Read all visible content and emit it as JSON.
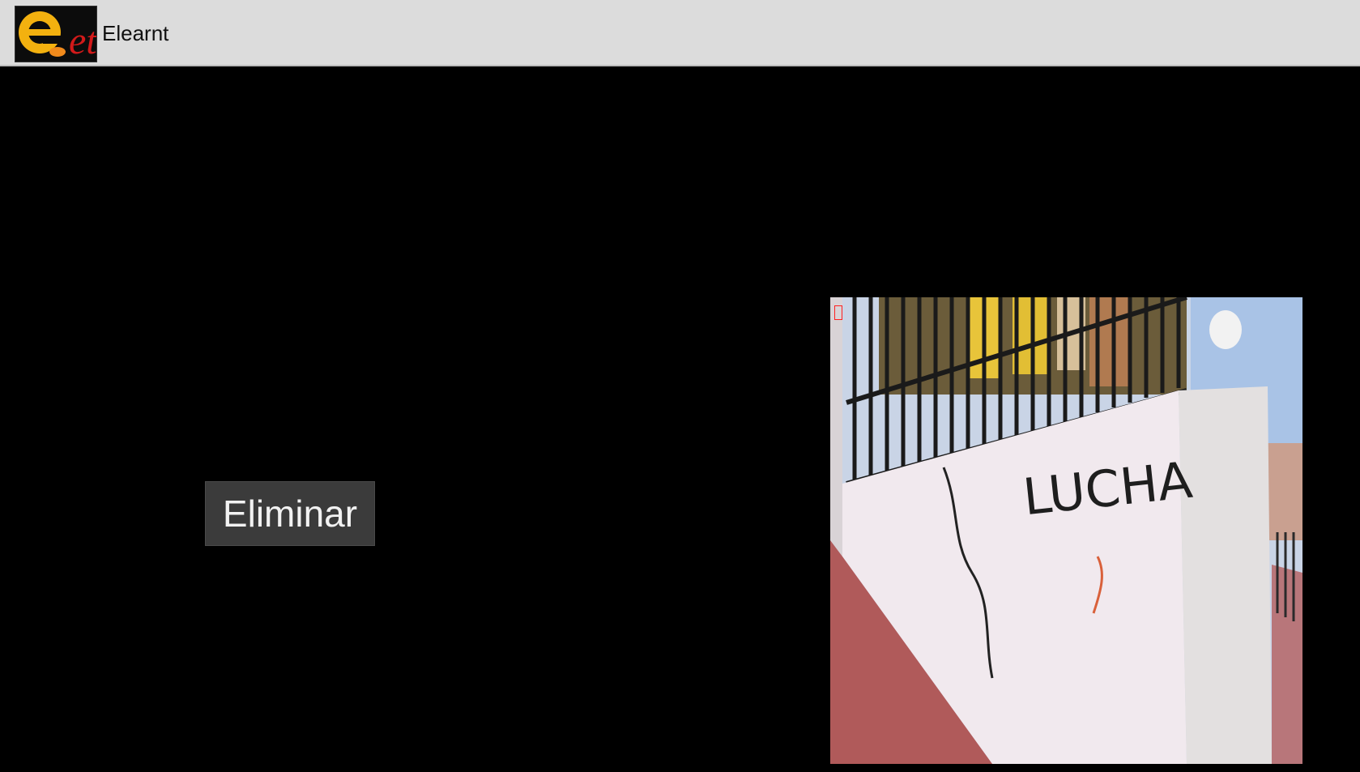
{
  "action_bar": {
    "title": "Elearnt",
    "logo_icon": "elearnt-logo-icon",
    "logo_text": "et"
  },
  "main": {
    "delete_button_label": "Eliminar",
    "photo": {
      "graffiti_text": "LUCHA",
      "icon": "photo-image"
    }
  },
  "colors": {
    "action_bar_bg": "#dcdcdc",
    "content_bg": "#000000",
    "button_bg": "#3b3b3b",
    "button_text": "#f2f2f2",
    "marker": "#ff2020"
  }
}
